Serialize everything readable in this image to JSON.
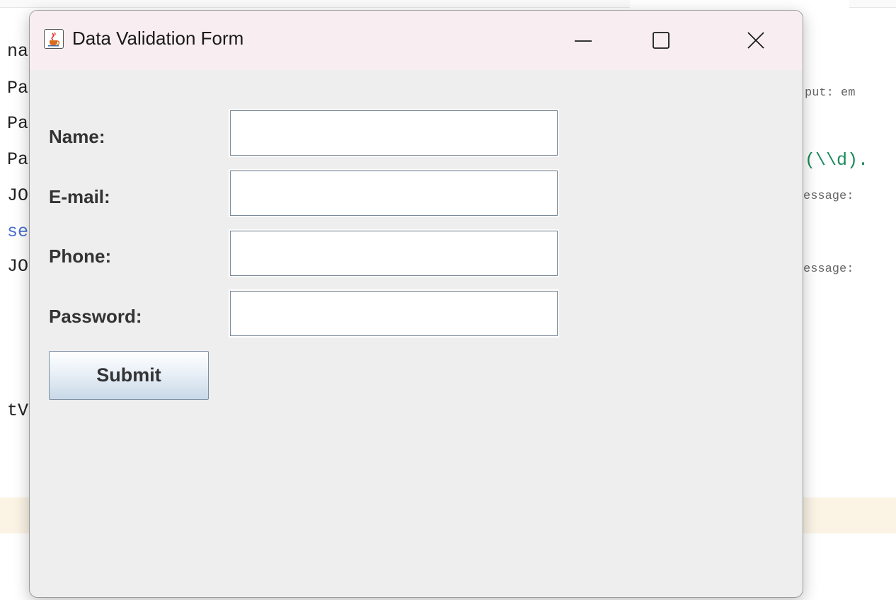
{
  "editor": {
    "left_fragments": [
      "na",
      "Pa",
      "Pa",
      "Pa",
      "JO",
      "se",
      "JO",
      "tV"
    ],
    "right_fragments": {
      "put_em": "put: em",
      "regex": "(\\\\d).",
      "message1": "essage:",
      "message2": "essage:"
    }
  },
  "window": {
    "title": "Data Validation Form",
    "app_icon": "java-cup-icon",
    "minimize_icon": "minimize-icon",
    "maximize_icon": "maximize-icon",
    "close_icon": "close-icon"
  },
  "form": {
    "fields": [
      {
        "label": "Name:",
        "value": ""
      },
      {
        "label": "E-mail:",
        "value": ""
      },
      {
        "label": "Phone:",
        "value": ""
      },
      {
        "label": "Password:",
        "value": ""
      }
    ],
    "submit_label": "Submit"
  },
  "colors": {
    "titlebar": "#f8eef2",
    "window_bg": "#eeeeee",
    "highlight_band": "#fbf4e4"
  }
}
